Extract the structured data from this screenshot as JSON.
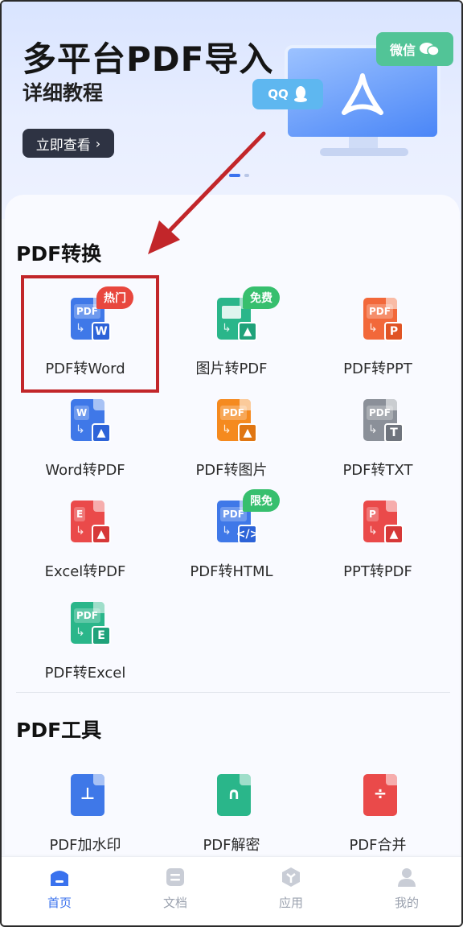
{
  "banner": {
    "title": "多平台PDF导入",
    "subtitle": "详细教程",
    "cta_label": "立即查看",
    "cta_chevron": "›",
    "wechat_label": "微信",
    "qq_label": "QQ"
  },
  "sections": {
    "convert_title": "PDF转换",
    "tools_title": "PDF工具"
  },
  "convert_items": [
    {
      "label": "PDF转Word",
      "badge": "热门",
      "tag": "PDF",
      "sub": "W",
      "color": "#3f78e8",
      "sub_color": "#2d63d8"
    },
    {
      "label": "图片转PDF",
      "badge": "免费",
      "tag": "",
      "sub": "▲",
      "color": "#2ab68a",
      "sub_color": "#1fa27a"
    },
    {
      "label": "PDF转PPT",
      "badge": "",
      "tag": "PDF",
      "sub": "P",
      "color": "#f2683a",
      "sub_color": "#e05425"
    },
    {
      "label": "Word转PDF",
      "badge": "",
      "tag": "W",
      "sub": "▲",
      "color": "#3f78e8",
      "sub_color": "#2d63d8"
    },
    {
      "label": "PDF转图片",
      "badge": "",
      "tag": "PDF",
      "sub": "▲",
      "color": "#f58a1f",
      "sub_color": "#e07612"
    },
    {
      "label": "PDF转TXT",
      "badge": "",
      "tag": "PDF",
      "sub": "T",
      "color": "#8b9099",
      "sub_color": "#6f747d"
    },
    {
      "label": "Excel转PDF",
      "badge": "",
      "tag": "E",
      "sub": "▲",
      "color": "#ea4a4a",
      "sub_color": "#d63838"
    },
    {
      "label": "PDF转HTML",
      "badge": "限免",
      "tag": "PDF",
      "sub": "</>",
      "color": "#3f78e8",
      "sub_color": "#2d63d8"
    },
    {
      "label": "PPT转PDF",
      "badge": "",
      "tag": "P",
      "sub": "▲",
      "color": "#ea4a4a",
      "sub_color": "#d63838"
    },
    {
      "label": "PDF转Excel",
      "badge": "",
      "tag": "PDF",
      "sub": "E",
      "color": "#2ab68a",
      "sub_color": "#1fa27a"
    }
  ],
  "tool_items": [
    {
      "label": "PDF加水印",
      "color": "#3f78e8"
    },
    {
      "label": "PDF解密",
      "color": "#2ab68a"
    },
    {
      "label": "PDF合并",
      "color": "#ea4a4a"
    }
  ],
  "nav": [
    {
      "label": "首页",
      "icon": "home-icon",
      "active": true
    },
    {
      "label": "文档",
      "icon": "document-icon",
      "active": false
    },
    {
      "label": "应用",
      "icon": "apps-cube-icon",
      "active": false
    },
    {
      "label": "我的",
      "icon": "profile-icon",
      "active": false
    }
  ],
  "colors": {
    "accent": "#3a72ee",
    "highlight": "#c2262a",
    "hot_badge": "#e8473e",
    "free_badge": "#37bf6e"
  }
}
